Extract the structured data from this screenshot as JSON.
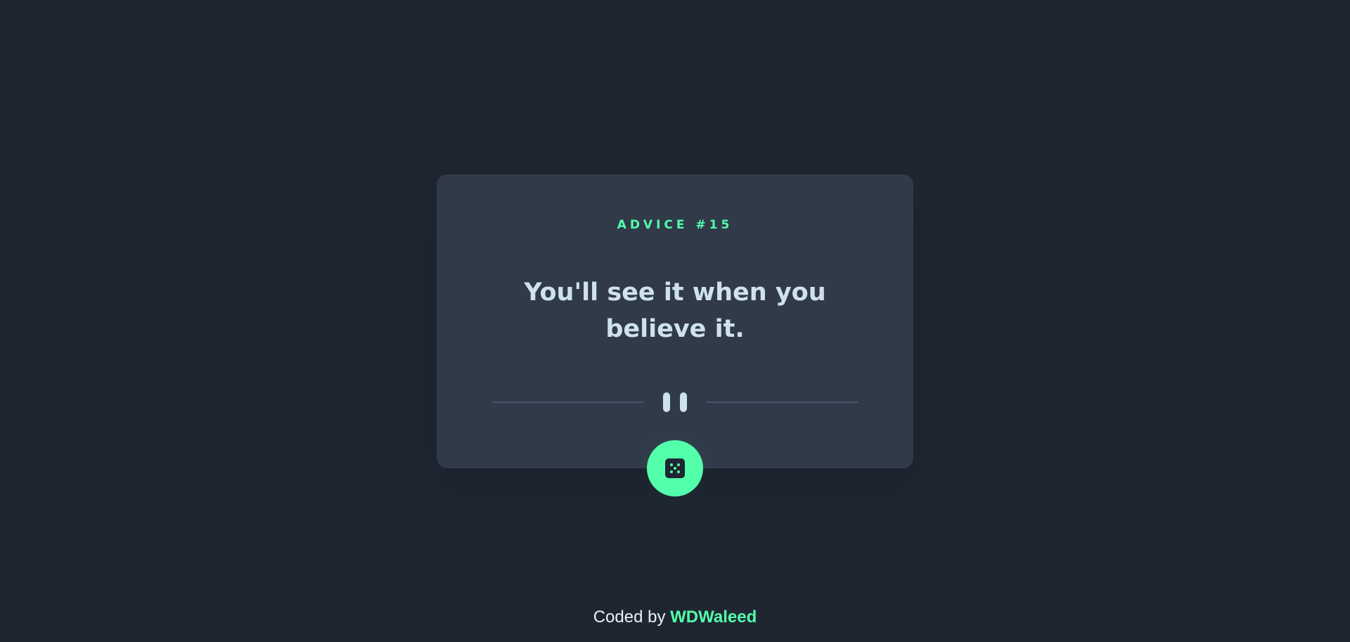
{
  "advice": {
    "heading": "ADVICE #15",
    "quote": "You'll see it when you believe it."
  },
  "footer": {
    "prefix": "Coded by",
    "author": "WDWaleed"
  },
  "icons": {
    "divider": "pause-divider-icon",
    "dice": "dice-icon"
  },
  "colors": {
    "background": "#1f2632",
    "card": "#313a49",
    "accent": "#53ffaa",
    "quote_text": "#cee3e9",
    "divider_line": "#4f5d74"
  }
}
